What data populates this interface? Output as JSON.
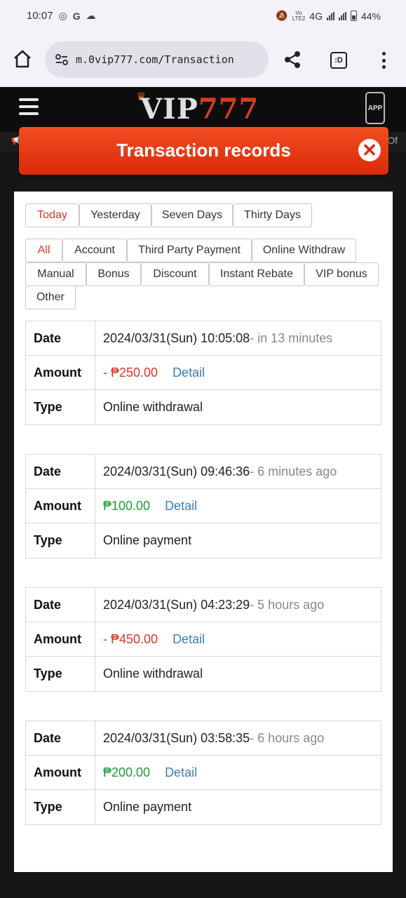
{
  "status_bar": {
    "time": "10:07",
    "left_icons": [
      "instagram-icon",
      "google-icon",
      "cloud-icon"
    ],
    "network": "4G",
    "volte": "VoLTE2",
    "battery": "44%"
  },
  "browser": {
    "url": "m.0vip777.com/Transaction",
    "tab_label": ":D"
  },
  "site": {
    "logo_vip": "VIP",
    "logo_777": "777",
    "app_label": "APP",
    "ticker_right": "Of"
  },
  "modal": {
    "title": "Transaction records",
    "close_symbol": "✕"
  },
  "period_tabs": [
    "Today",
    "Yesterday",
    "Seven Days",
    "Thirty Days"
  ],
  "type_filters": [
    "All",
    "Account",
    "Third Party Payment",
    "Online Withdraw",
    "Manual",
    "Bonus",
    "Discount",
    "Instant Rebate",
    "VIP bonus",
    "Other"
  ],
  "labels": {
    "date": "Date",
    "amount": "Amount",
    "type": "Type",
    "detail": "Detail"
  },
  "records": [
    {
      "date": "2024/03/31(Sun) 10:05:08",
      "relative": "- in 13 minutes",
      "amount": "- ₱250.00",
      "type": "Online withdrawal"
    },
    {
      "date": "2024/03/31(Sun) 09:46:36",
      "relative": "- 6 minutes ago",
      "amount": "₱100.00",
      "type": "Online payment"
    },
    {
      "date": "2024/03/31(Sun) 04:23:29",
      "relative": "- 5 hours ago",
      "amount": "- ₱450.00",
      "type": "Online withdrawal"
    },
    {
      "date": "2024/03/31(Sun) 03:58:35",
      "relative": "- 6 hours ago",
      "amount": "₱200.00",
      "type": "Online payment"
    }
  ],
  "colors": {
    "negative_amount": "#d9372a",
    "positive_amount": "#1f9a3a",
    "detail_link": "#3a7dbb",
    "modal_header": "#e63a14"
  }
}
